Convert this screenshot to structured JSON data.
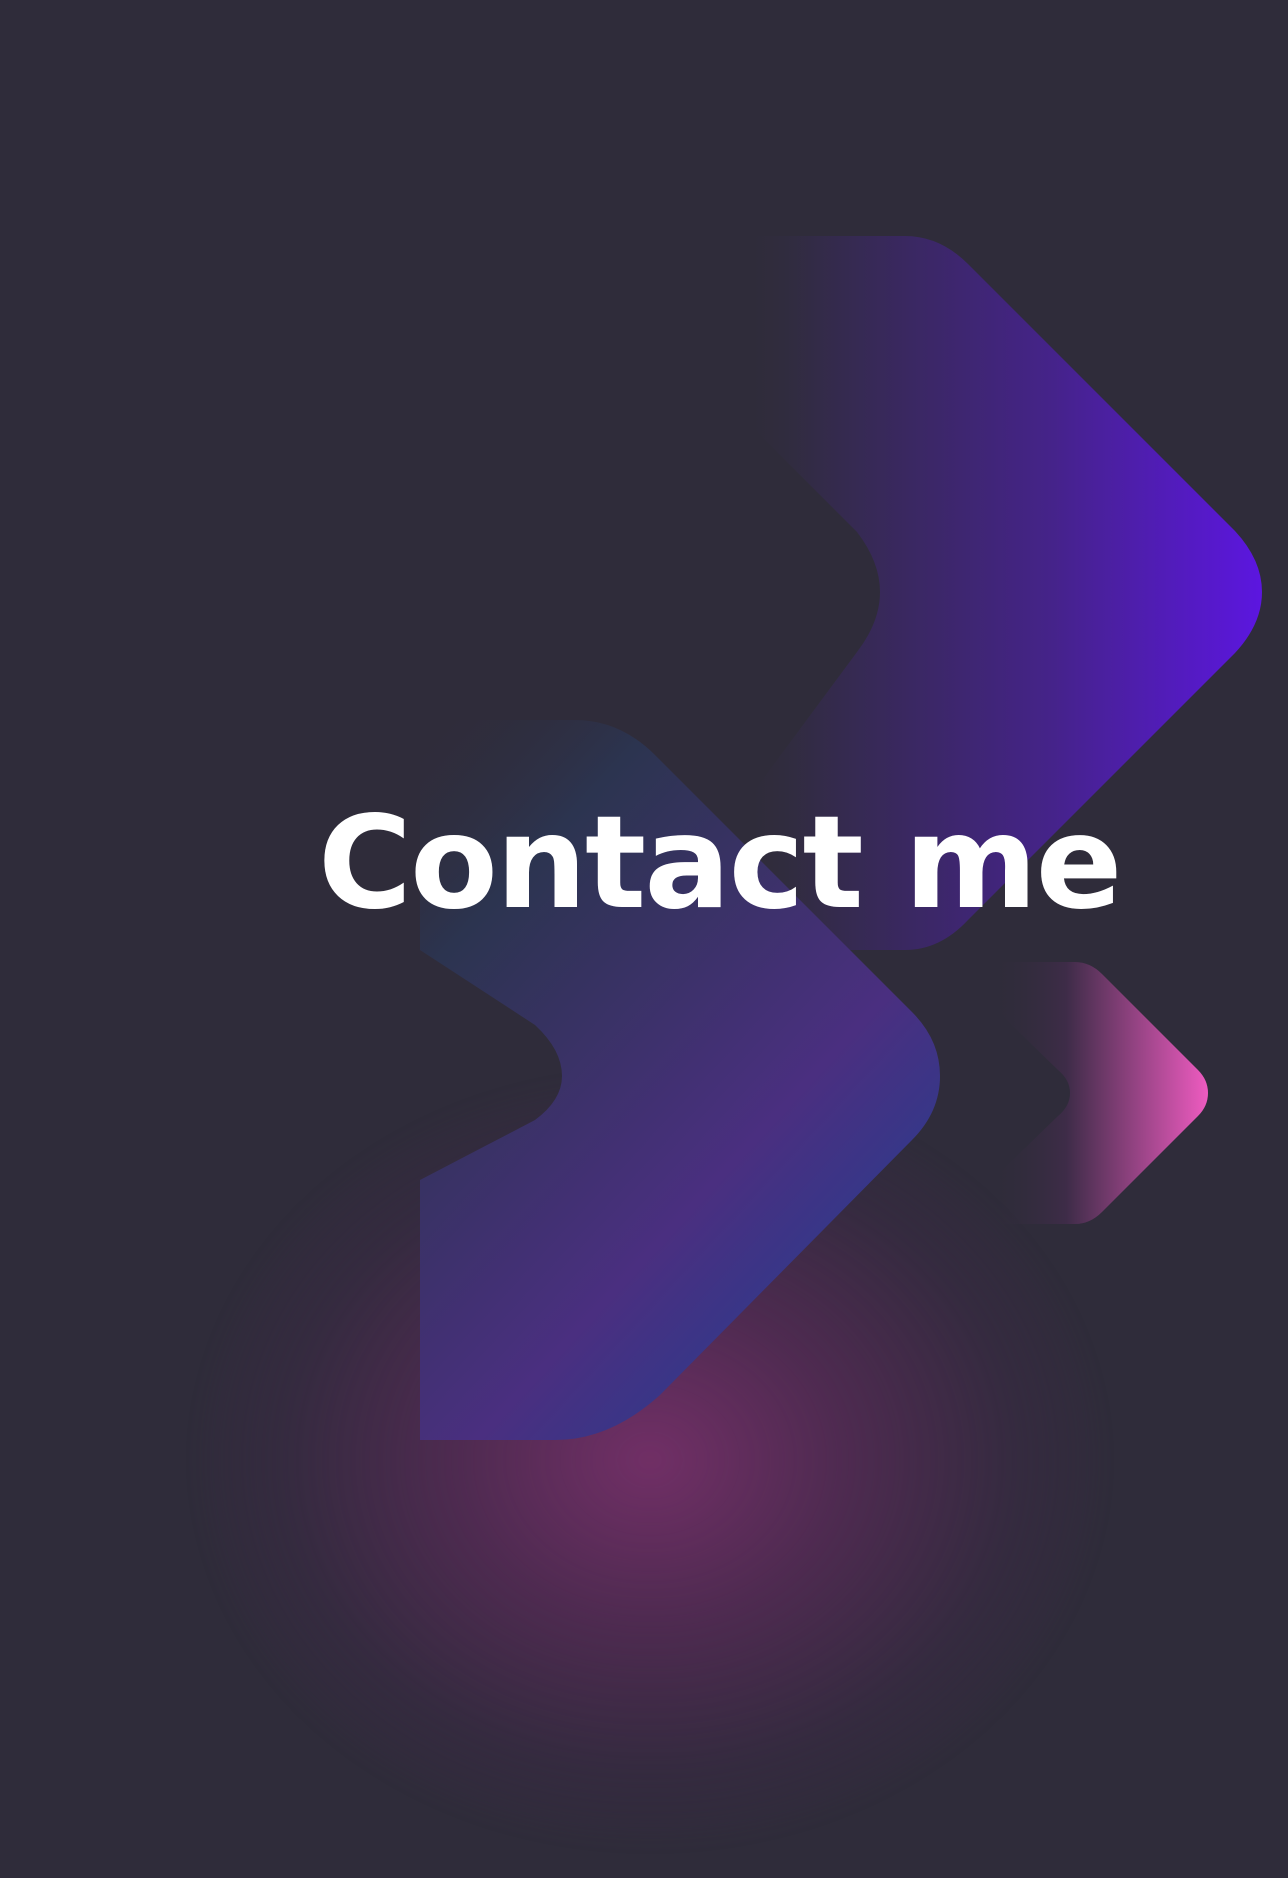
{
  "page": {
    "headline": "Contact me"
  },
  "decoration": {
    "background_color": "#2f2c3a",
    "chevron_large_colors": [
      "#2f2c3a",
      "#5c16e0"
    ],
    "chevron_middle_colors": [
      "#2f2c3a",
      "#2e3a8c"
    ],
    "chevron_small_colors": [
      "#2f2c3a",
      "#ee5bc0"
    ],
    "glow_color": "#7d306e"
  }
}
